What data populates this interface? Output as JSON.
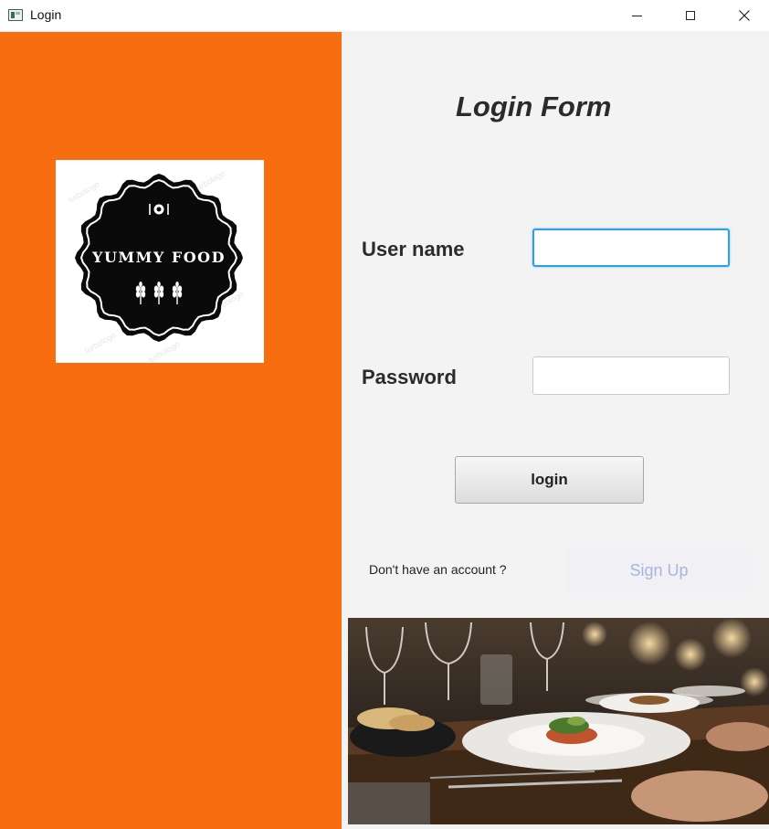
{
  "window": {
    "title": "Login",
    "controls": [
      "minimize",
      "maximize",
      "close"
    ]
  },
  "logo": {
    "brand_text": "YUMMY FOOD",
    "watermark": "turbologo",
    "badge_color": "#0a0a0a"
  },
  "form": {
    "title": "Login Form",
    "username_label": "User name",
    "username_value": "",
    "password_label": "Password",
    "password_value": "",
    "login_button": "login",
    "no_account_text": "Don't have an account ?",
    "signup_button": "Sign Up"
  },
  "colors": {
    "left_panel": "#f76d10",
    "right_panel": "#f3f3f4",
    "focus_border": "#29a3e6",
    "signup_text": "#a9b5dd"
  },
  "icons": {
    "app": "app-window-icon",
    "minimize": "minimize-icon",
    "maximize": "maximize-icon",
    "close": "close-icon",
    "dish": "dish-plate-icon",
    "wheat": "wheat-icon"
  }
}
